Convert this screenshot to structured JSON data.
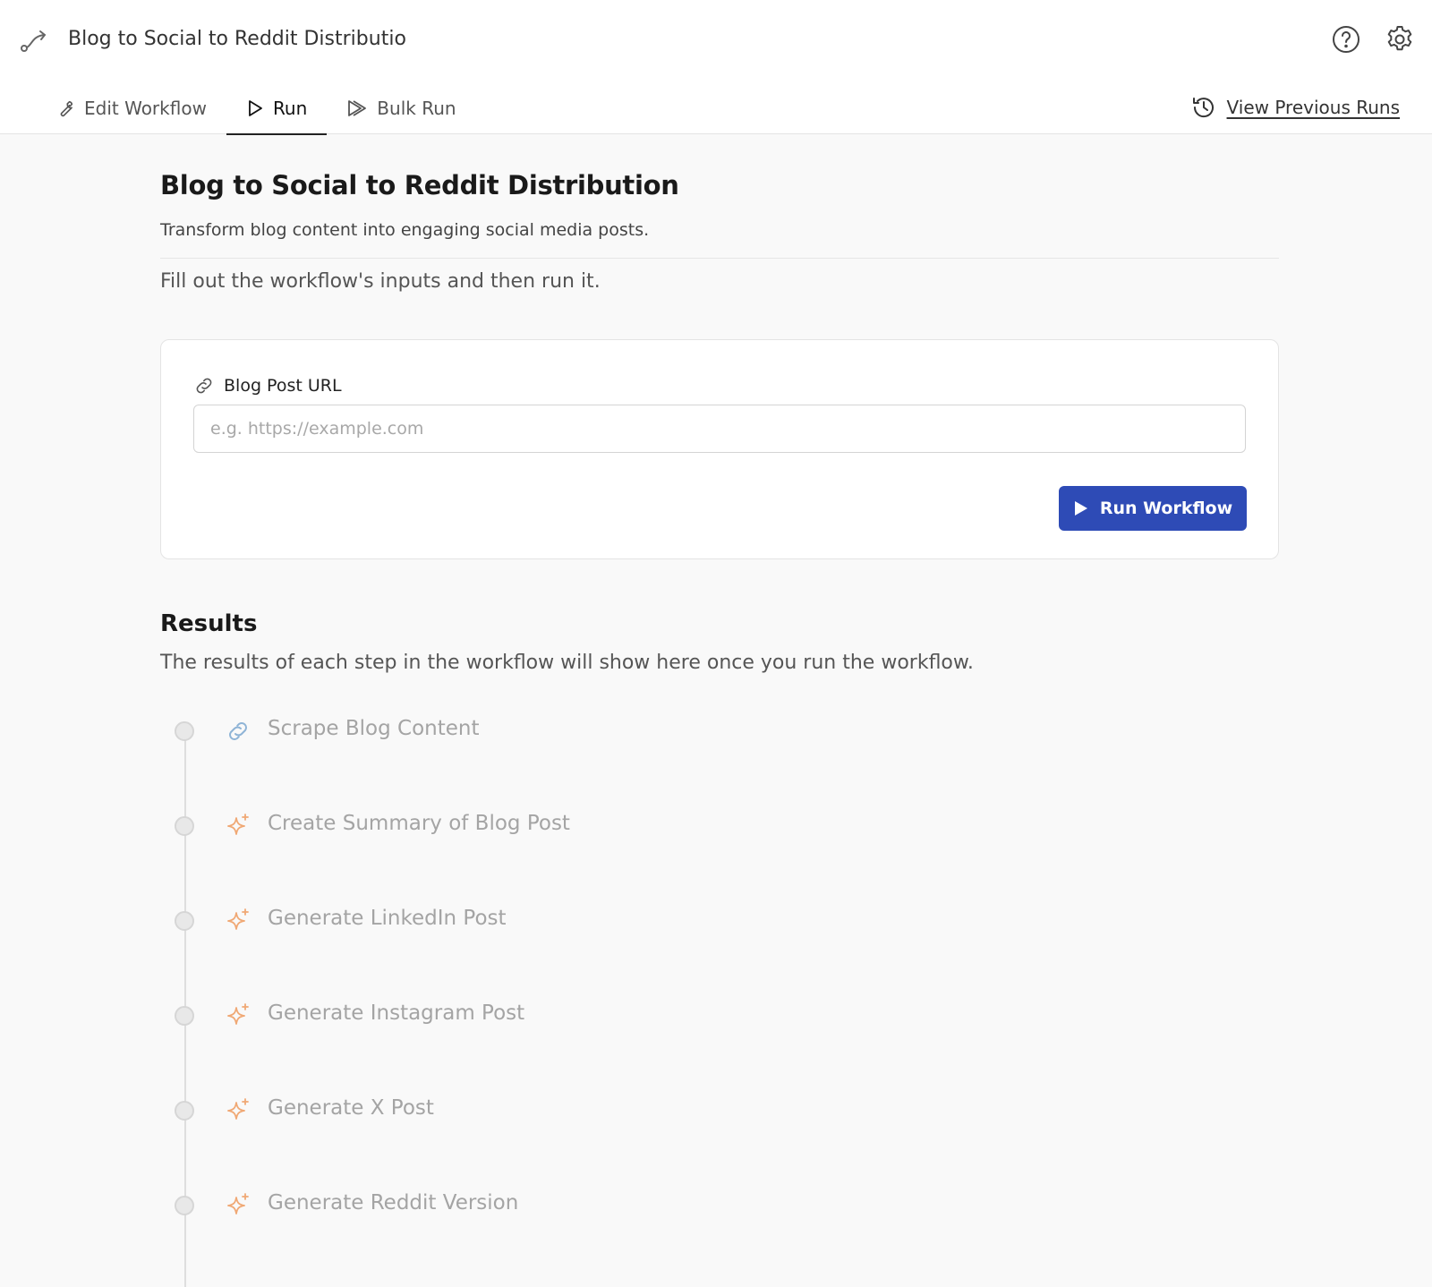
{
  "app": {
    "workflow_title": "Blog to Social to Reddit Distribution",
    "icons": {
      "app": "workflow-icon",
      "help": "help-icon",
      "settings": "gear-icon"
    }
  },
  "tabs": [
    {
      "label": "Edit Workflow",
      "icon": "wrench-icon",
      "active": false
    },
    {
      "label": "Run",
      "icon": "play-outline-icon",
      "active": true
    },
    {
      "label": "Bulk Run",
      "icon": "double-play-icon",
      "active": false
    }
  ],
  "header_actions": {
    "view_previous_runs": "View Previous Runs",
    "icon": "history-icon"
  },
  "page": {
    "title": "Blog to Social to Reddit Distribution",
    "description": "Transform blog content into engaging social media posts.",
    "hint": "Fill out the workflow's inputs and then run it."
  },
  "form": {
    "field_label": "Blog Post URL",
    "field_icon": "link-icon",
    "field_value": "",
    "field_placeholder": "e.g. https://example.com",
    "run_button": "Run Workflow"
  },
  "results": {
    "title": "Results",
    "description": "The results of each step in the workflow will show here once you run the workflow.",
    "steps": [
      {
        "label": "Scrape Blog Content",
        "icon": "link-icon"
      },
      {
        "label": "Create Summary of Blog Post",
        "icon": "sparkle-icon"
      },
      {
        "label": "Generate LinkedIn Post",
        "icon": "sparkle-icon"
      },
      {
        "label": "Generate Instagram Post",
        "icon": "sparkle-icon"
      },
      {
        "label": "Generate X Post",
        "icon": "sparkle-icon"
      },
      {
        "label": "Generate Reddit Version",
        "icon": "sparkle-icon"
      }
    ]
  },
  "colors": {
    "primary": "#2e4bb6",
    "link_icon_step": "#8fb4d6",
    "sparkle_icon": "#f0a874",
    "muted_text": "#a4a4a4"
  }
}
